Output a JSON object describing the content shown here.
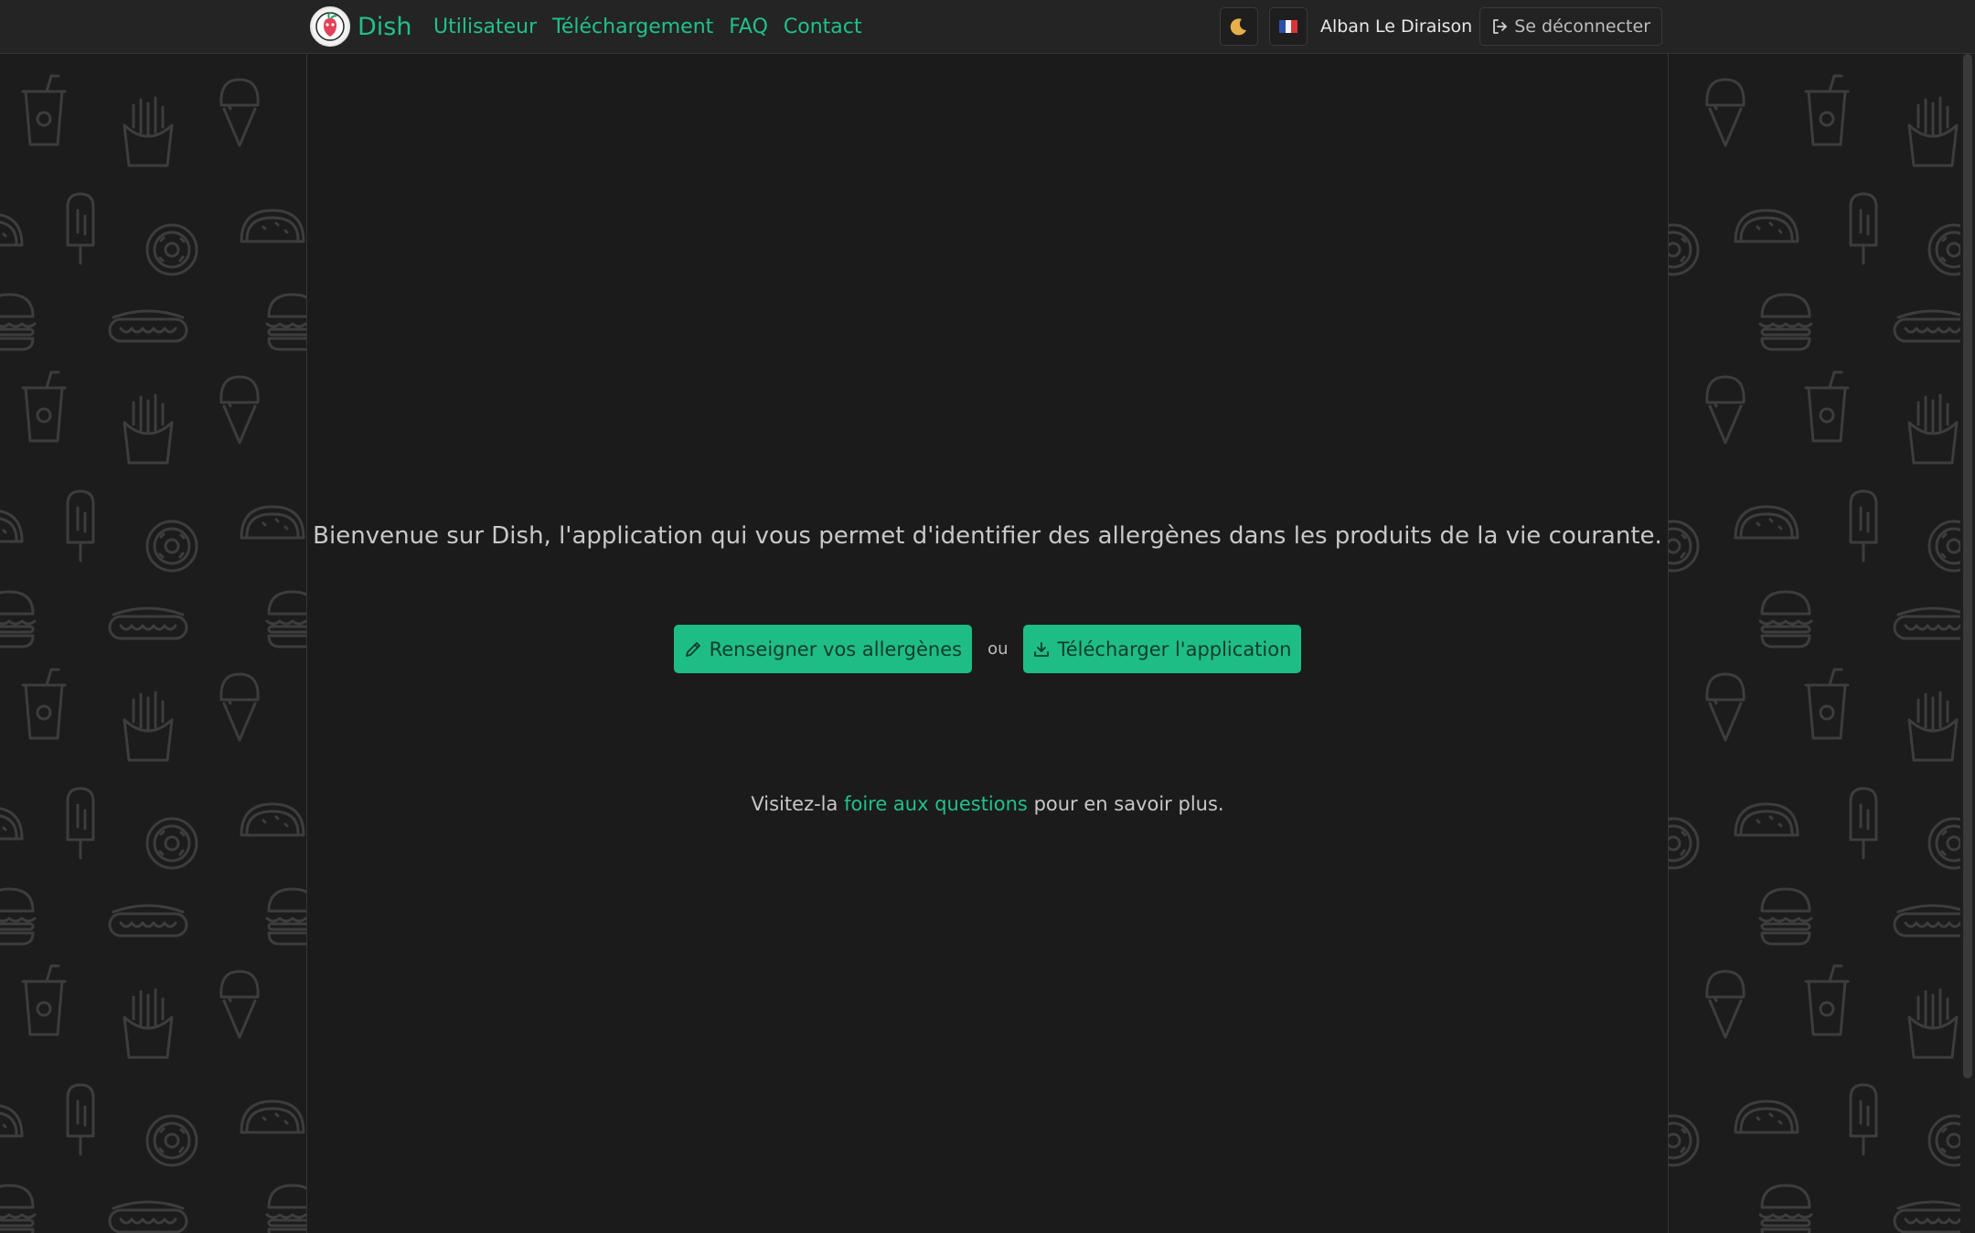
{
  "navbar": {
    "brand_name": "Dish",
    "links": [
      {
        "label": "Utilisateur"
      },
      {
        "label": "Téléchargement"
      },
      {
        "label": "FAQ"
      },
      {
        "label": "Contact"
      }
    ],
    "theme_toggle_icon": "moon-icon",
    "language_icon": "french-flag-icon",
    "user_name": "Alban Le Diraison",
    "logout_label": "Se déconnecter"
  },
  "main": {
    "welcome_text": "Bienvenue sur Dish, l'application qui vous permet d'identifier des allergènes dans les produits de la vie courante.",
    "primary_button_label": "Renseigner vos allergènes",
    "or_label": "ou",
    "secondary_button_label": "Télécharger l'application",
    "faq_prefix": "Visitez-la",
    "faq_link": "foire aux questions",
    "faq_suffix": "pour en savoir plus."
  },
  "colors": {
    "accent": "#21c18a",
    "background": "#1b1b1b",
    "navbar": "#242424"
  },
  "background_icons": [
    "drink-cup-icon",
    "fries-icon",
    "ice-cream-cone-icon",
    "popsicle-icon",
    "donut-icon",
    "taco-icon",
    "hotdog-icon",
    "burger-icon"
  ]
}
